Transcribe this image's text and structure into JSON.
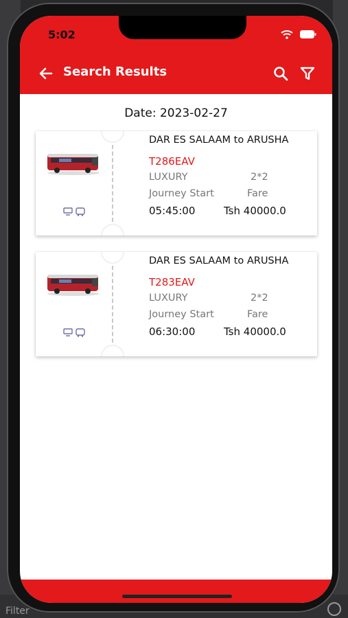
{
  "background": {
    "filter_label": "Filter"
  },
  "status_bar": {
    "time": "5:02"
  },
  "app_bar": {
    "title": "Search Results"
  },
  "date_line": "Date: 2023-02-27",
  "tickets": [
    {
      "route": "DAR ES SALAAM to ARUSHA",
      "registration": "T286EAV",
      "bus_class": "LUXURY",
      "seat_layout": "2*2",
      "journey_start_label": "Journey Start",
      "fare_label": "Fare",
      "departure_time": "05:45:00",
      "fare": "Tsh  40000.0"
    },
    {
      "route": "DAR ES SALAAM to ARUSHA",
      "registration": "T283EAV",
      "bus_class": "LUXURY",
      "seat_layout": "2*2",
      "journey_start_label": "Journey Start",
      "fare_label": "Fare",
      "departure_time": "06:30:00",
      "fare": "Tsh  40000.0"
    }
  ],
  "colors": {
    "primary": "#e3191b",
    "muted_text": "#777777",
    "text": "#111111"
  },
  "icons": [
    "back-arrow-icon",
    "search-icon",
    "filter-icon",
    "wifi-icon",
    "battery-icon",
    "bus-image",
    "amenity-icons"
  ]
}
